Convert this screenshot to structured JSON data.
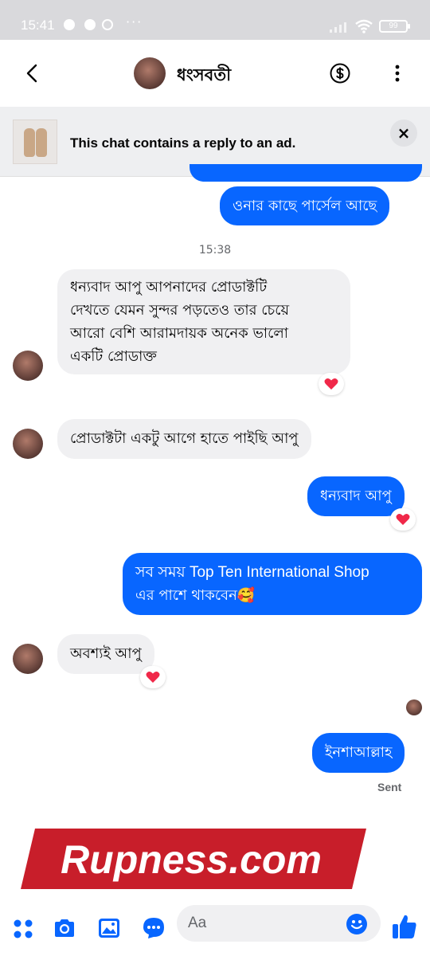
{
  "status_bar": {
    "time": "15:41",
    "more": "···",
    "battery": "99"
  },
  "header": {
    "contact_name": "ধংসবতী"
  },
  "ad_banner": {
    "text": "This chat contains a reply to an ad.",
    "close": "×"
  },
  "messages": [
    {
      "side": "out",
      "text": "ওনার কাছে পার্সেল আছে"
    },
    {
      "type": "timestamp",
      "text": "15:38"
    },
    {
      "side": "in",
      "lines": [
        "ধন্যবাদ আপু আপনাদের প্রোডাক্টটি",
        "দেখতে যেমন সুন্দর পড়তেও তার চেয়ে",
        "আরো বেশি আরামদায়ক অনেক ভালো",
        "একটি প্রোডাক্ত"
      ],
      "reaction": "heart"
    },
    {
      "side": "in",
      "text": "প্রোডাক্টটা একটু আগে হাতে পাইছি আপু"
    },
    {
      "side": "out",
      "text": "ধন্যবাদ আপু",
      "reaction": "heart"
    },
    {
      "side": "out",
      "lines": [
        "সব সময় Top Ten International Shop",
        "এর পাশে থাকবেন🥰"
      ]
    },
    {
      "side": "in",
      "text": "অবশ্যই আপু",
      "reaction": "heart"
    },
    {
      "side": "out",
      "text": "ইনশাআল্লাহ"
    }
  ],
  "sent_label": "Sent",
  "watermark": "Rupness.com",
  "composer": {
    "placeholder": "Aa"
  },
  "colors": {
    "outgoing_bubble": "#0866ff",
    "incoming_bubble": "#f0f0f2",
    "accent": "#0866ff",
    "watermark_bg": "#c81e2a",
    "heart": "#f02849"
  },
  "icons": [
    "back-icon",
    "dollar-icon",
    "more-vert-icon",
    "close-icon",
    "menu-dots-icon",
    "camera-icon",
    "gallery-icon",
    "voice-icon",
    "emoji-icon",
    "thumbs-up-icon"
  ]
}
